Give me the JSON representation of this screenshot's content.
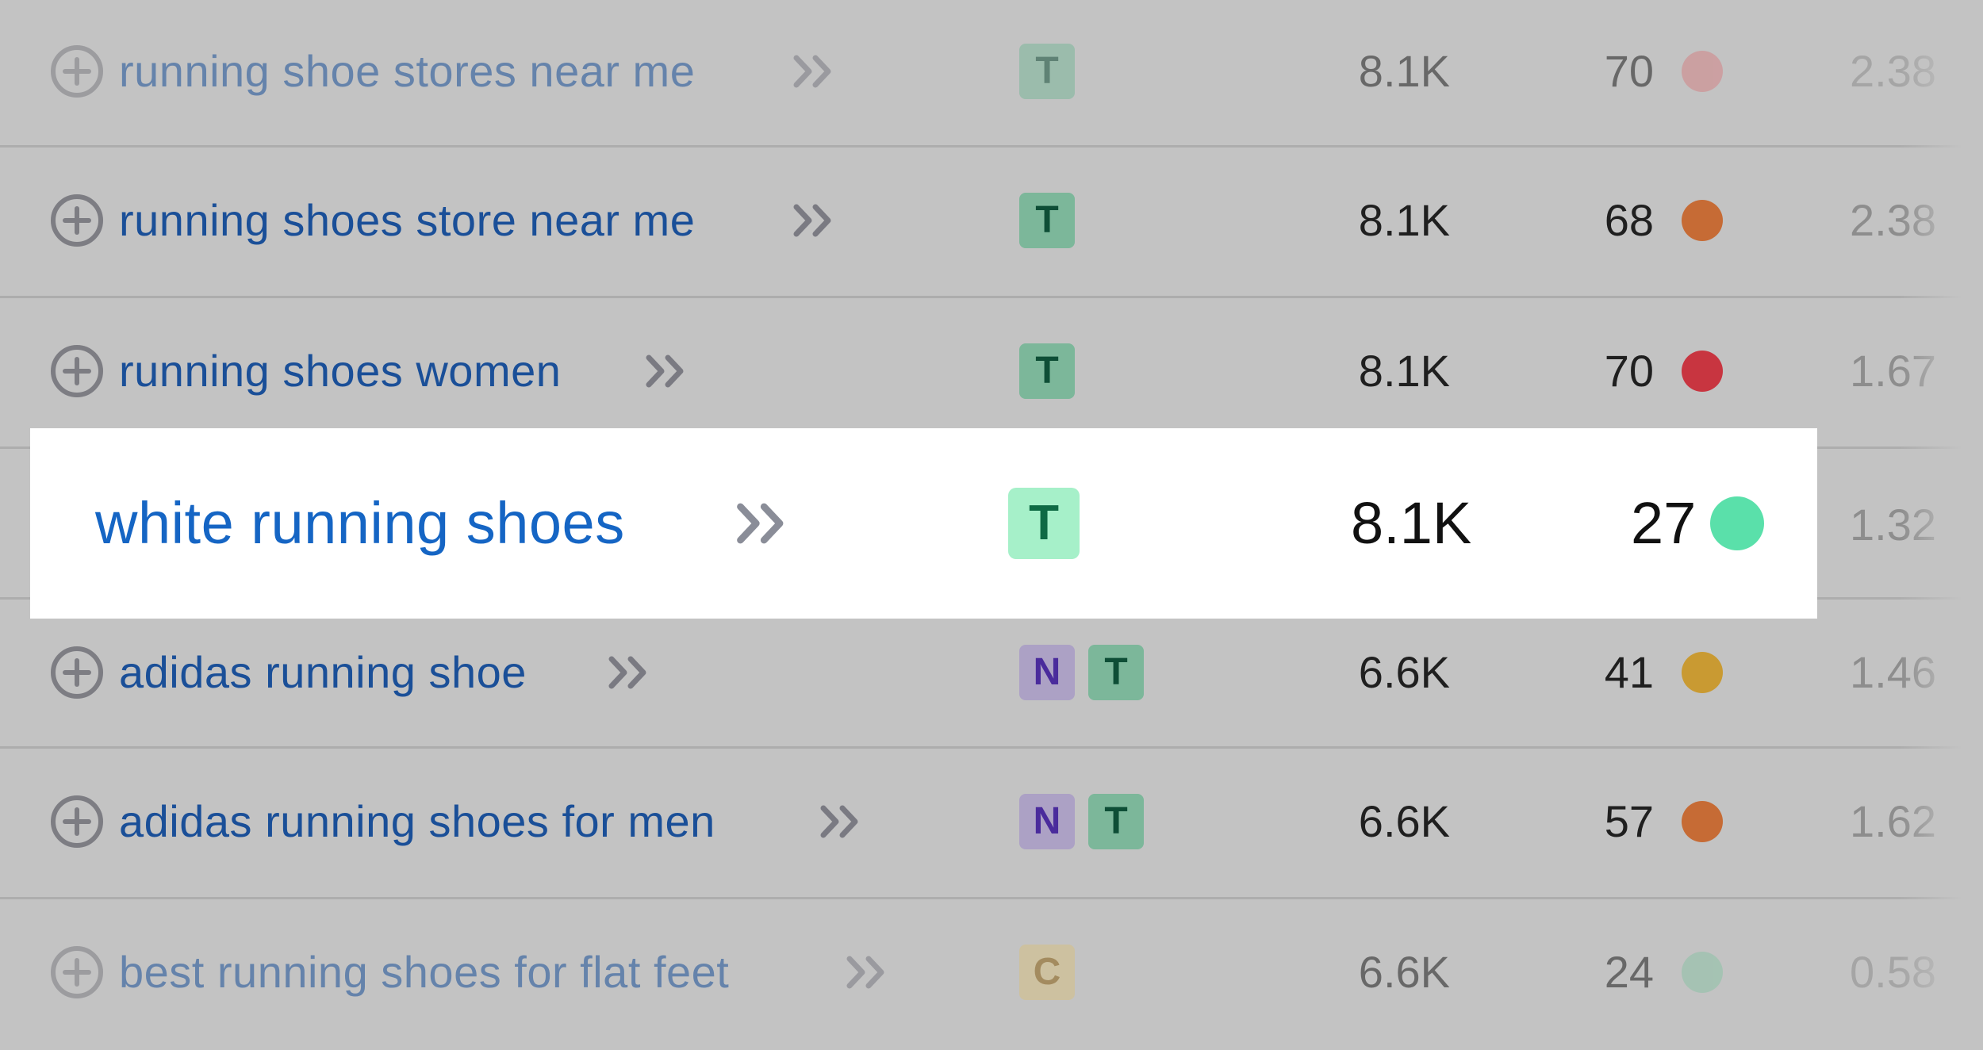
{
  "rows": [
    {
      "keyword": "running shoe stores near me",
      "intents": [
        "T"
      ],
      "volume": "8.1K",
      "kd": "70",
      "kd_color": "#d38487",
      "cpc": "2.38",
      "faded": true
    },
    {
      "keyword": "running shoes store near me",
      "intents": [
        "T"
      ],
      "volume": "8.1K",
      "kd": "68",
      "kd_color": "#c66b35",
      "cpc": "2.38",
      "faded": false
    },
    {
      "keyword": "running shoes women",
      "intents": [
        "T"
      ],
      "volume": "8.1K",
      "kd": "70",
      "kd_color": "#c83540",
      "cpc": "1.67",
      "faded": false
    },
    {
      "keyword": "white running shoes",
      "intents": [
        "T"
      ],
      "volume": "8.1K",
      "kd": "27",
      "kd_color": "#5ae0aa",
      "cpc": "1.32",
      "faded": false,
      "highlighted": true
    },
    {
      "keyword": "adidas running shoe",
      "intents": [
        "N",
        "T"
      ],
      "volume": "6.6K",
      "kd": "41",
      "kd_color": "#c99a32",
      "cpc": "1.46",
      "faded": false
    },
    {
      "keyword": "adidas running shoes for men",
      "intents": [
        "N",
        "T"
      ],
      "volume": "6.6K",
      "kd": "57",
      "kd_color": "#c66b35",
      "cpc": "1.62",
      "faded": false
    },
    {
      "keyword": "best running shoes for flat feet",
      "intents": [
        "C"
      ],
      "volume": "6.6K",
      "kd": "24",
      "kd_color": "#8dc2a6",
      "cpc": "0.58",
      "faded": true
    }
  ],
  "icons": {
    "add": "plus-circle-icon",
    "open": "double-chevron-right-icon"
  }
}
